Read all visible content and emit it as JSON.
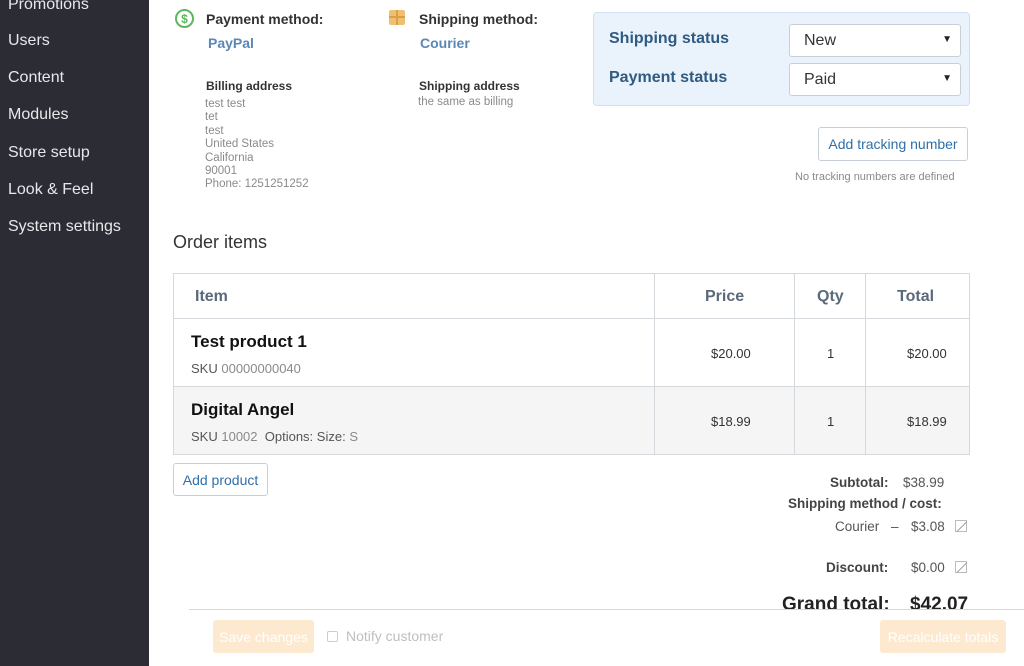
{
  "sidebar": {
    "items": [
      {
        "label": "Promotions"
      },
      {
        "label": "Users"
      },
      {
        "label": "Content"
      },
      {
        "label": "Modules"
      },
      {
        "label": "Store setup"
      },
      {
        "label": "Look & Feel"
      },
      {
        "label": "System settings"
      }
    ]
  },
  "order": {
    "payment_method_label": "Payment method:",
    "payment_method_value": "PayPal",
    "shipping_method_label": "Shipping method:",
    "shipping_method_value": "Courier",
    "billing_title": "Billing address",
    "billing_lines": [
      "test test",
      "tet",
      "test",
      "United States",
      "California",
      "90001",
      "Phone: 1251251252"
    ],
    "shipping_title": "Shipping address",
    "shipping_value": "the same as billing",
    "dollar_glyph": "$"
  },
  "status": {
    "shipping_label": "Shipping status",
    "shipping_value": "New",
    "payment_label": "Payment status",
    "payment_value": "Paid",
    "caret": "▼"
  },
  "tracking": {
    "button_label": "Add tracking number",
    "empty_note": "No tracking numbers are defined"
  },
  "items_section": {
    "title": "Order items",
    "columns": {
      "item": "Item",
      "price": "Price",
      "qty": "Qty",
      "total": "Total"
    },
    "rows": [
      {
        "name": "Test product 1",
        "sku_label": "SKU",
        "sku": "00000000040",
        "options_label": "",
        "options_value": "",
        "price": "$20.00",
        "qty": "1",
        "total": "$20.00"
      },
      {
        "name": "Digital Angel",
        "sku_label": "SKU",
        "sku": "10002",
        "options_label": "Options: Size:",
        "options_value": "S",
        "price": "$18.99",
        "qty": "1",
        "total": "$18.99"
      }
    ],
    "add_product_label": "Add product"
  },
  "totals": {
    "subtotal_label": "Subtotal:",
    "subtotal_value": "$38.99",
    "shipping_label": "Shipping method / cost:",
    "shipping_method": "Courier",
    "shipping_sep": "–",
    "shipping_cost": "$3.08",
    "discount_label": "Discount:",
    "discount_value": "$0.00",
    "grand_label": "Grand total:",
    "grand_value": "$42.07"
  },
  "footer": {
    "save_label": "Save changes",
    "notify_label": "Notify customer",
    "recalc_label": "Recalculate totals"
  },
  "colors": {
    "sidebar_bg": "#2c2c35",
    "accent_link": "#5b87b5",
    "status_panel_bg": "#eaf3fc",
    "disabled_button": "#fde9cf"
  }
}
